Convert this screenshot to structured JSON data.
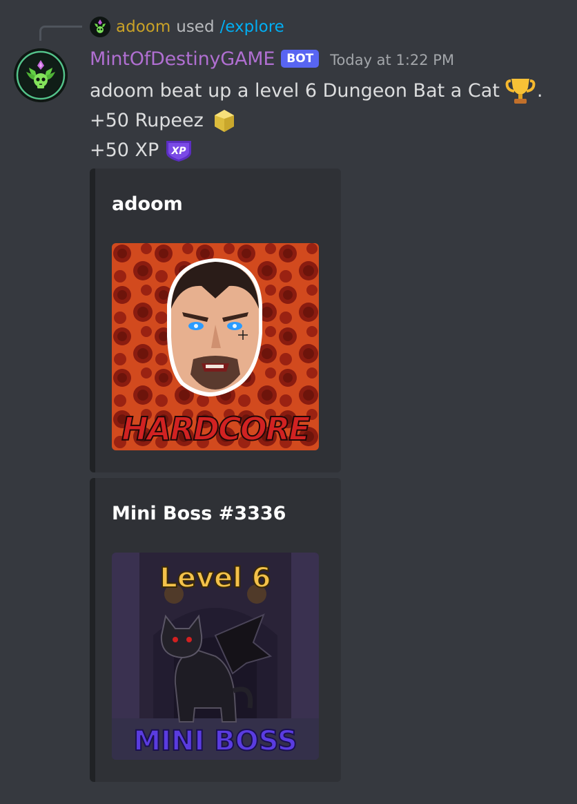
{
  "reply": {
    "user": "adoom",
    "used_text": "used",
    "command": "/explore",
    "avatar_icon": "skull-crest-icon"
  },
  "author": {
    "name": "MintOfDestinyGAME",
    "tag": "BOT",
    "timestamp": "Today at 1:22 PM",
    "avatar_icon": "skull-crest-icon",
    "name_color": "#b06fd1"
  },
  "content": {
    "line1": "adoom beat up a level 6 Dungeon Bat a Cat",
    "line1_end": ".",
    "line1_emoji": "trophy-icon",
    "line2": "+50 Rupeez",
    "line2_emoji": "rupeez-gem-icon",
    "line3": "+50 XP",
    "line3_emoji": "xp-badge-icon",
    "xp_badge_text": "XP"
  },
  "embeds": [
    {
      "title": "adoom",
      "image_caption": "HARDCORE"
    },
    {
      "title": "Mini Boss #3336",
      "image_top_text": "Level 6",
      "image_bottom_text": "MINI BOSS"
    }
  ]
}
